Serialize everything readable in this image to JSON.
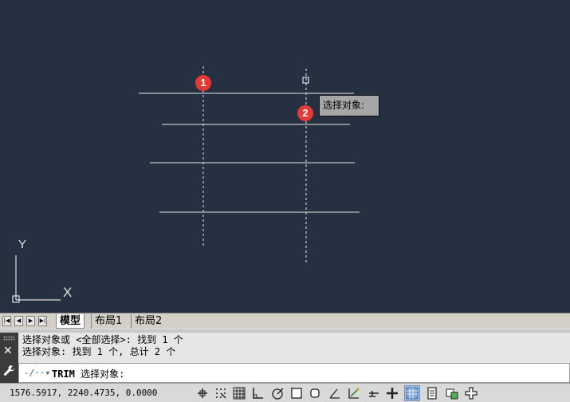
{
  "tooltip": {
    "text": "选择对象:"
  },
  "markers": {
    "m1": "1",
    "m2": "2"
  },
  "ucs": {
    "y_label": "Y",
    "x_label": "X"
  },
  "tabs": {
    "model": "模型",
    "layout1": "布局1",
    "layout2": "布局2"
  },
  "command": {
    "history": [
      "选择对象或 <全部选择>: 找到 1 个",
      "选择对象: 找到 1 个, 总计 2 个"
    ],
    "current_command": "TRIM",
    "prompt": "选择对象:"
  },
  "status": {
    "coordinates": "1576.5917, 2240.4735, 0.0000",
    "toggles": [
      {
        "name": "infer-constraints",
        "active": false
      },
      {
        "name": "snap-mode",
        "active": false
      },
      {
        "name": "grid-display",
        "active": false
      },
      {
        "name": "ortho-mode",
        "active": false
      },
      {
        "name": "polar-tracking",
        "active": false
      },
      {
        "name": "object-snap",
        "active": false
      },
      {
        "name": "3d-object-snap",
        "active": false
      },
      {
        "name": "object-snap-tracking",
        "active": false
      },
      {
        "name": "dynamic-ucs",
        "active": false
      },
      {
        "name": "dynamic-input",
        "active": false
      },
      {
        "name": "lineweight",
        "active": false
      },
      {
        "name": "transparency",
        "active": true
      },
      {
        "name": "quick-properties",
        "active": false
      },
      {
        "name": "selection-cycling",
        "active": false
      },
      {
        "name": "annotation-monitor",
        "active": false
      }
    ]
  },
  "colors": {
    "background": "#253040",
    "marker": "#e53935",
    "line": "#e6e6e6"
  }
}
